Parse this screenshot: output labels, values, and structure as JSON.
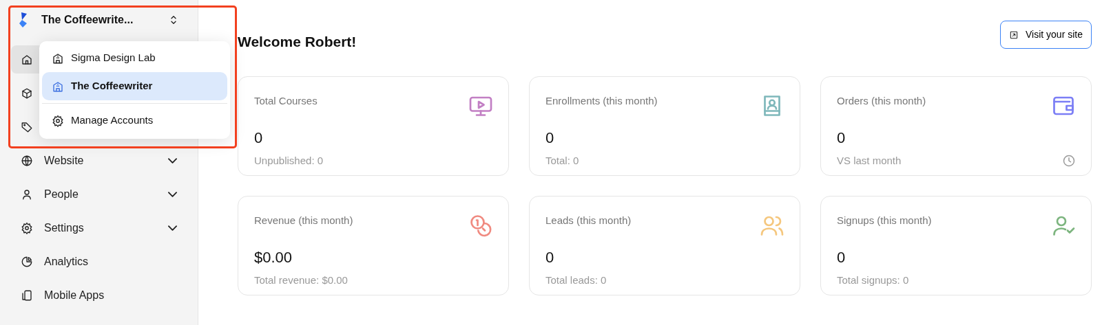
{
  "account_switcher": {
    "label": "The Coffeewrite..."
  },
  "sidebar": {
    "items": [
      {
        "selected": true
      },
      {
        "selected": false
      },
      {
        "selected": false
      },
      {
        "label": "Website",
        "expandable": true,
        "selected": false
      },
      {
        "label": "People",
        "expandable": true,
        "selected": false
      },
      {
        "label": "Settings",
        "expandable": true,
        "selected": false
      },
      {
        "label": "Analytics",
        "expandable": false,
        "selected": false
      },
      {
        "label": "Mobile Apps",
        "expandable": false,
        "selected": false
      }
    ]
  },
  "account_menu": {
    "accounts": [
      {
        "label": "Sigma Design Lab",
        "selected": false
      },
      {
        "label": "The Coffeewriter",
        "selected": true
      }
    ],
    "manage": "Manage Accounts"
  },
  "header": {
    "title": "Welcome Robert!",
    "button": "Visit your site"
  },
  "stats": [
    {
      "title": "Total Courses",
      "value": "0",
      "sub": "Unpublished: 0",
      "color": "#c27fc4",
      "clock": false
    },
    {
      "title": "Enrollments (this month)",
      "value": "0",
      "sub": "Total: 0",
      "color": "#7fb8bb",
      "clock": false
    },
    {
      "title": "Orders (this month)",
      "value": "0",
      "sub": "VS last month",
      "color": "#7b7ef5",
      "clock": true
    },
    {
      "title": "Revenue (this month)",
      "value": "$0.00",
      "sub": "Total revenue: $0.00",
      "color": "#f08a80",
      "clock": false
    },
    {
      "title": "Leads (this month)",
      "value": "0",
      "sub": "Total leads: 0",
      "color": "#f5c77e",
      "clock": false
    },
    {
      "title": "Signups (this month)",
      "value": "0",
      "sub": "Total signups: 0",
      "color": "#7db57f",
      "clock": false
    }
  ]
}
